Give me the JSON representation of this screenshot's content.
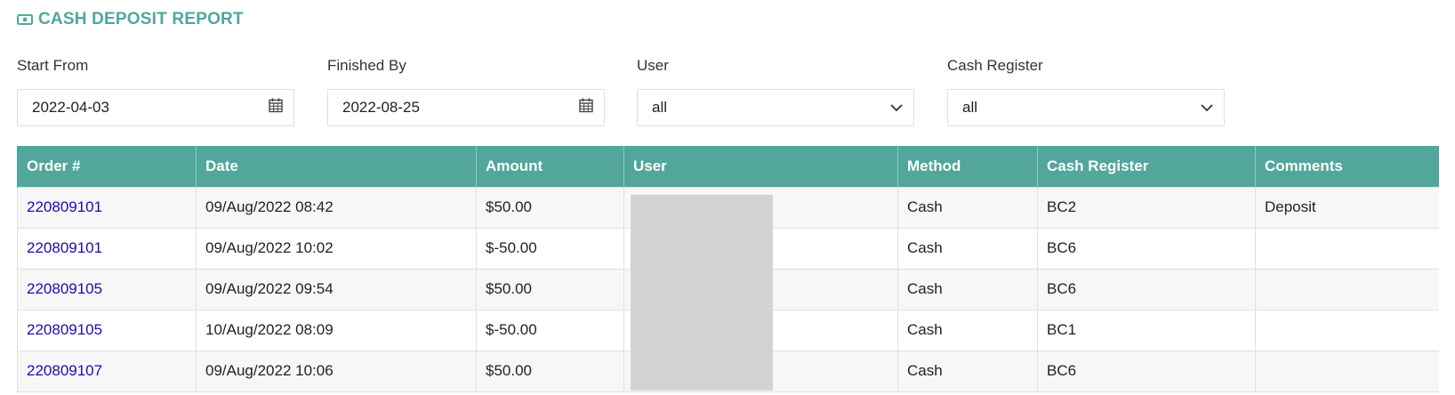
{
  "header": {
    "title": "CASH DEPOSIT REPORT",
    "icon": "cash-icon",
    "accent": "#4fa89c"
  },
  "filters": {
    "start": {
      "label": "Start From",
      "value": "2022-04-03"
    },
    "end": {
      "label": "Finished By",
      "value": "2022-08-25"
    },
    "user": {
      "label": "User",
      "value": "all"
    },
    "register": {
      "label": "Cash Register",
      "value": "all"
    }
  },
  "table": {
    "header_color": "#52a69b",
    "columns": [
      "Order #",
      "Date",
      "Amount",
      "User",
      "Method",
      "Cash Register",
      "Comments"
    ],
    "rows": [
      {
        "order": "220809101",
        "date": "09/Aug/2022 08:42",
        "amount": "$50.00",
        "user": "",
        "method": "Cash",
        "register": "BC2",
        "comments": "Deposit"
      },
      {
        "order": "220809101",
        "date": "09/Aug/2022 10:02",
        "amount": "$-50.00",
        "user": "",
        "method": "Cash",
        "register": "BC6",
        "comments": ""
      },
      {
        "order": "220809105",
        "date": "09/Aug/2022 09:54",
        "amount": "$50.00",
        "user": "",
        "method": "Cash",
        "register": "BC6",
        "comments": ""
      },
      {
        "order": "220809105",
        "date": "10/Aug/2022 08:09",
        "amount": "$-50.00",
        "user": "",
        "method": "Cash",
        "register": "BC1",
        "comments": ""
      },
      {
        "order": "220809107",
        "date": "09/Aug/2022 10:06",
        "amount": "$50.00",
        "user": "",
        "method": "Cash",
        "register": "BC6",
        "comments": ""
      }
    ]
  }
}
